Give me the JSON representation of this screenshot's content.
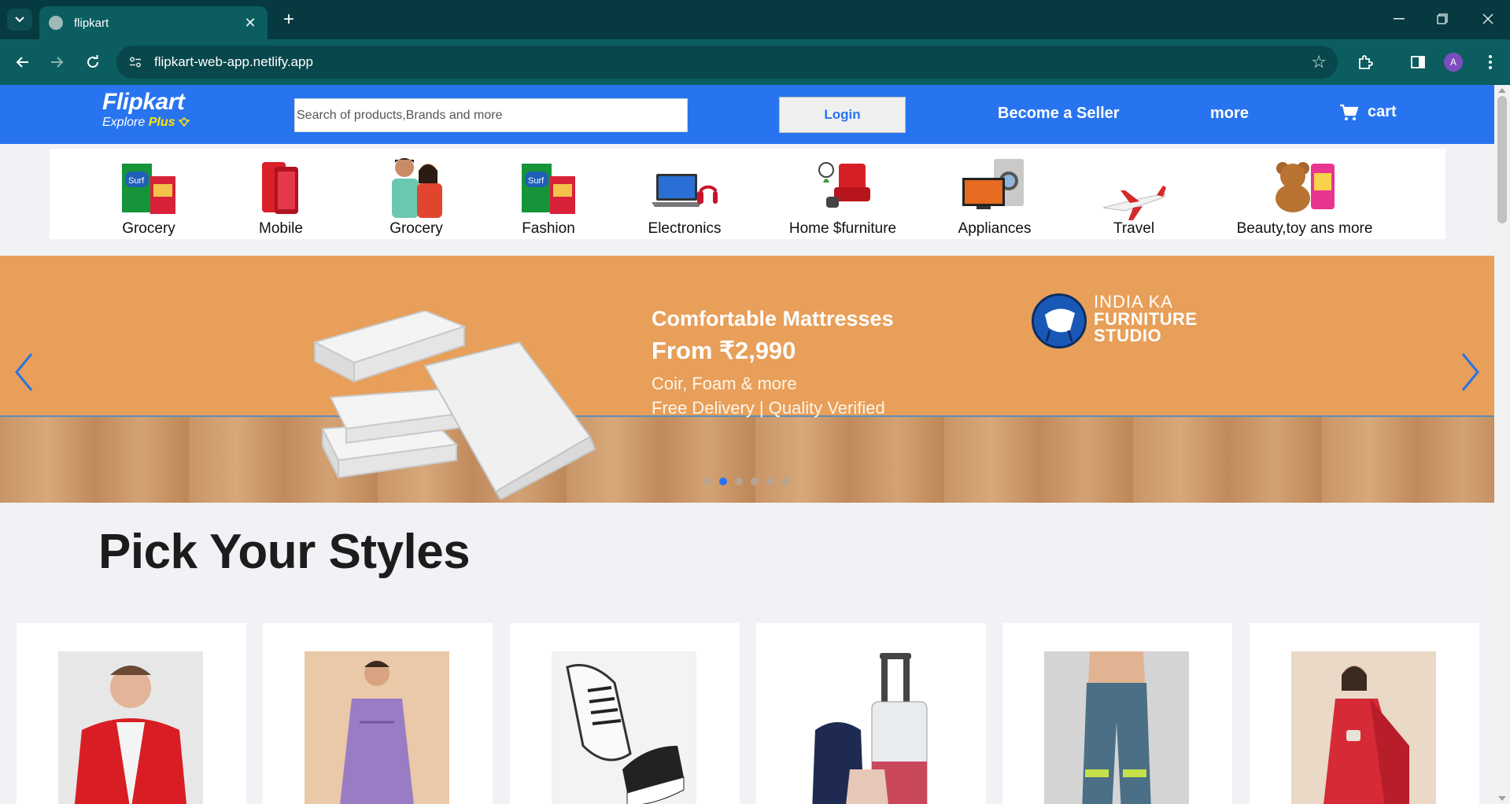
{
  "browser": {
    "tab_title": "flipkart",
    "url": "flipkart-web-app.netlify.app",
    "profile_initial": "A",
    "icons": {
      "tab_list": "chevron-down-icon",
      "favicon": "globe-icon",
      "close_tab": "close-icon",
      "new_tab": "plus-icon",
      "back": "arrow-left-icon",
      "forward": "arrow-right-icon",
      "reload": "reload-icon",
      "site_info": "tune-icon",
      "bookmark": "star-icon",
      "extensions": "puzzle-icon",
      "side_panel": "side-panel-icon",
      "menu": "kebab-menu-icon",
      "minimize": "minimize-icon",
      "restore": "restore-icon",
      "close_window": "close-icon"
    }
  },
  "header": {
    "logo_word": "Flipkart",
    "logo_tag_prefix": "Explore ",
    "logo_tag_plus": "Plus",
    "search_placeholder": "Search of products,Brands and more",
    "login_label": "Login",
    "seller_label": "Become a Seller",
    "more_label": "more",
    "cart_label": "cart",
    "colors": {
      "brand_blue": "#2874f0",
      "plus_yellow": "#ffe500"
    }
  },
  "categories": [
    {
      "label": "Grocery"
    },
    {
      "label": "Mobile"
    },
    {
      "label": "Grocery"
    },
    {
      "label": "Fashion"
    },
    {
      "label": "Electronics"
    },
    {
      "label": "Home $furniture"
    },
    {
      "label": "Appliances"
    },
    {
      "label": "Travel"
    },
    {
      "label": "Beauty,toy ans more"
    }
  ],
  "banner": {
    "headline": "Comfortable Mattresses",
    "price": "From ₹2,990",
    "sub1": "Coir, Foam & more",
    "sub2": "Free Delivery | Quality Verified",
    "studio_line1": "INDIA KA",
    "studio_line2": "FURNITURE",
    "studio_line3": "STUDIO",
    "active_slide": 2,
    "slide_count": 6
  },
  "styles_section": {
    "title": "Pick Your Styles",
    "cards": [
      {
        "item": "red jacket"
      },
      {
        "item": "purple kurta"
      },
      {
        "item": "sneakers"
      },
      {
        "item": "luggage set"
      },
      {
        "item": "track pants"
      },
      {
        "item": "red saree"
      }
    ]
  }
}
